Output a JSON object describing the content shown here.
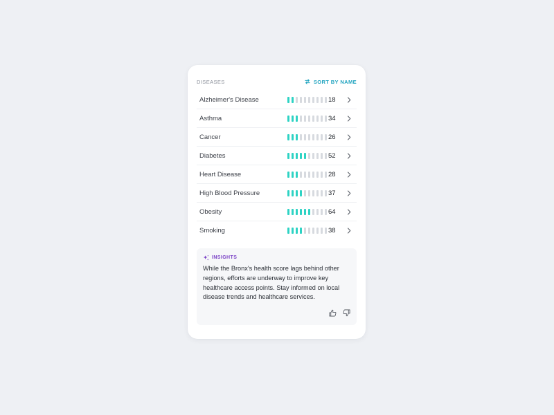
{
  "header": {
    "label": "DISEASES",
    "sort_label": "SORT BY NAME"
  },
  "diseases": [
    {
      "name": "Alzheimer's Disease",
      "value": "18",
      "segments_filled": 2
    },
    {
      "name": "Asthma",
      "value": "34",
      "segments_filled": 3
    },
    {
      "name": "Cancer",
      "value": "26",
      "segments_filled": 3
    },
    {
      "name": "Diabetes",
      "value": "52",
      "segments_filled": 5
    },
    {
      "name": "Heart Disease",
      "value": "28",
      "segments_filled": 3
    },
    {
      "name": "High Blood Pressure",
      "value": "37",
      "segments_filled": 4
    },
    {
      "name": "Obesity",
      "value": "64",
      "segments_filled": 6
    },
    {
      "name": "Smoking",
      "value": "38",
      "segments_filled": 4
    }
  ],
  "bar_segments_total": 10,
  "insights": {
    "title": "INSIGHTS",
    "body": "While the Bronx's health score lags behind other regions, efforts are underway to improve key healthcare access points. Stay informed on local disease trends and healthcare services."
  },
  "colors": {
    "accent_teal": "#2ed3c4",
    "sort_blue": "#1fa3bf",
    "insights_purple": "#7b43c6",
    "segment_empty": "#d7dadf"
  },
  "icons": {
    "sort": "sort-arrows-icon",
    "row_action": "chevron-right-icon",
    "insights": "sparkle-icon",
    "like": "thumbs-up-icon",
    "dislike": "thumbs-down-icon"
  }
}
